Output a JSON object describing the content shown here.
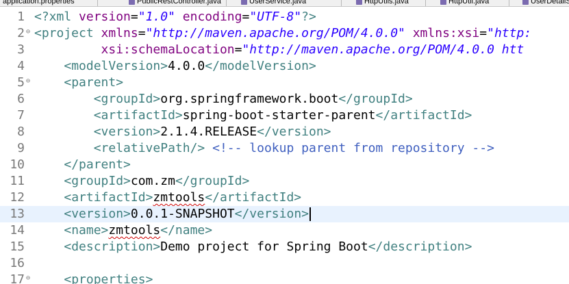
{
  "tabs": [
    {
      "label": "application.properties",
      "icon": "properties-file-icon"
    },
    {
      "label": "PublicRestController.java",
      "icon": "java-file-icon"
    },
    {
      "label": "UserService.java",
      "icon": "java-file-icon"
    },
    {
      "label": "HttpUtils.java",
      "icon": "java-file-icon"
    },
    {
      "label": "HttpUtil.java",
      "icon": "java-file-icon"
    },
    {
      "label": "UserDetailS",
      "icon": "java-file-icon"
    }
  ],
  "editor": {
    "current_line": 13,
    "lines": [
      {
        "n": "1",
        "fold": "",
        "segs": [
          [
            "pi",
            "<?xml "
          ],
          [
            "attr",
            "version"
          ],
          [
            "txt",
            "="
          ],
          [
            "val",
            "\"1.0\""
          ],
          [
            "txt",
            " "
          ],
          [
            "attr",
            "encoding"
          ],
          [
            "txt",
            "="
          ],
          [
            "val",
            "\"UTF-8\""
          ],
          [
            "pi",
            "?>"
          ]
        ]
      },
      {
        "n": "2",
        "fold": "⊖",
        "segs": [
          [
            "tag",
            "<project "
          ],
          [
            "attr",
            "xmlns"
          ],
          [
            "txt",
            "="
          ],
          [
            "val",
            "\"http://maven.apache.org/POM/4.0.0\""
          ],
          [
            "txt",
            " "
          ],
          [
            "attr",
            "xmlns:xsi"
          ],
          [
            "txt",
            "="
          ],
          [
            "val",
            "\"http:"
          ]
        ]
      },
      {
        "n": "3",
        "fold": "",
        "segs": [
          [
            "txt",
            "         "
          ],
          [
            "attr",
            "xsi:schemaLocation"
          ],
          [
            "txt",
            "="
          ],
          [
            "val",
            "\"http://maven.apache.org/POM/4.0.0 htt"
          ]
        ]
      },
      {
        "n": "4",
        "fold": "",
        "segs": [
          [
            "txt",
            "    "
          ],
          [
            "tag",
            "<modelVersion>"
          ],
          [
            "txt",
            "4.0.0"
          ],
          [
            "tag",
            "</modelVersion>"
          ]
        ]
      },
      {
        "n": "5",
        "fold": "⊖",
        "segs": [
          [
            "txt",
            "    "
          ],
          [
            "tag",
            "<parent>"
          ]
        ]
      },
      {
        "n": "6",
        "fold": "",
        "segs": [
          [
            "txt",
            "        "
          ],
          [
            "tag",
            "<groupId>"
          ],
          [
            "txt",
            "org.springframework.boot"
          ],
          [
            "tag",
            "</groupId>"
          ]
        ]
      },
      {
        "n": "7",
        "fold": "",
        "segs": [
          [
            "txt",
            "        "
          ],
          [
            "tag",
            "<artifactId>"
          ],
          [
            "txt",
            "spring-boot-starter-parent"
          ],
          [
            "tag",
            "</artifactId>"
          ]
        ]
      },
      {
        "n": "8",
        "fold": "",
        "segs": [
          [
            "txt",
            "        "
          ],
          [
            "tag",
            "<version>"
          ],
          [
            "txt",
            "2.1.4.RELEASE"
          ],
          [
            "tag",
            "</version>"
          ]
        ]
      },
      {
        "n": "9",
        "fold": "",
        "segs": [
          [
            "txt",
            "        "
          ],
          [
            "tag",
            "<relativePath/>"
          ],
          [
            "txt",
            " "
          ],
          [
            "cmt",
            "<!-- lookup parent from repository -->"
          ]
        ]
      },
      {
        "n": "10",
        "fold": "",
        "segs": [
          [
            "txt",
            "    "
          ],
          [
            "tag",
            "</parent>"
          ]
        ]
      },
      {
        "n": "11",
        "fold": "",
        "segs": [
          [
            "txt",
            "    "
          ],
          [
            "tag",
            "<groupId>"
          ],
          [
            "txt",
            "com.zm"
          ],
          [
            "tag",
            "</groupId>"
          ]
        ]
      },
      {
        "n": "12",
        "fold": "",
        "segs": [
          [
            "txt",
            "    "
          ],
          [
            "tag",
            "<artifactId>"
          ],
          [
            "squig",
            "zmtools"
          ],
          [
            "tag",
            "</artifactId>"
          ]
        ]
      },
      {
        "n": "13",
        "fold": "",
        "segs": [
          [
            "txt",
            "    "
          ],
          [
            "tag",
            "<version>"
          ],
          [
            "txt",
            "0.0.1-SNAPSHOT"
          ],
          [
            "tag",
            "</version>"
          ],
          [
            "caret",
            ""
          ]
        ]
      },
      {
        "n": "14",
        "fold": "",
        "segs": [
          [
            "txt",
            "    "
          ],
          [
            "tag",
            "<name>"
          ],
          [
            "squig",
            "zmtools"
          ],
          [
            "tag",
            "</name>"
          ]
        ]
      },
      {
        "n": "15",
        "fold": "",
        "segs": [
          [
            "txt",
            "    "
          ],
          [
            "tag",
            "<description>"
          ],
          [
            "txt",
            "Demo project for Spring Boot"
          ],
          [
            "tag",
            "</description>"
          ]
        ]
      },
      {
        "n": "16",
        "fold": "",
        "segs": []
      },
      {
        "n": "17",
        "fold": "⊖",
        "segs": [
          [
            "txt",
            "    "
          ],
          [
            "tag",
            "<properties>"
          ]
        ]
      }
    ]
  },
  "colors": {
    "tag": "#3f7f7f",
    "attribute": "#7f007f",
    "string": "#2a00ff",
    "comment": "#3f5fbf",
    "current_line": "#e8f2fe",
    "spellcheck": "#d00000"
  }
}
